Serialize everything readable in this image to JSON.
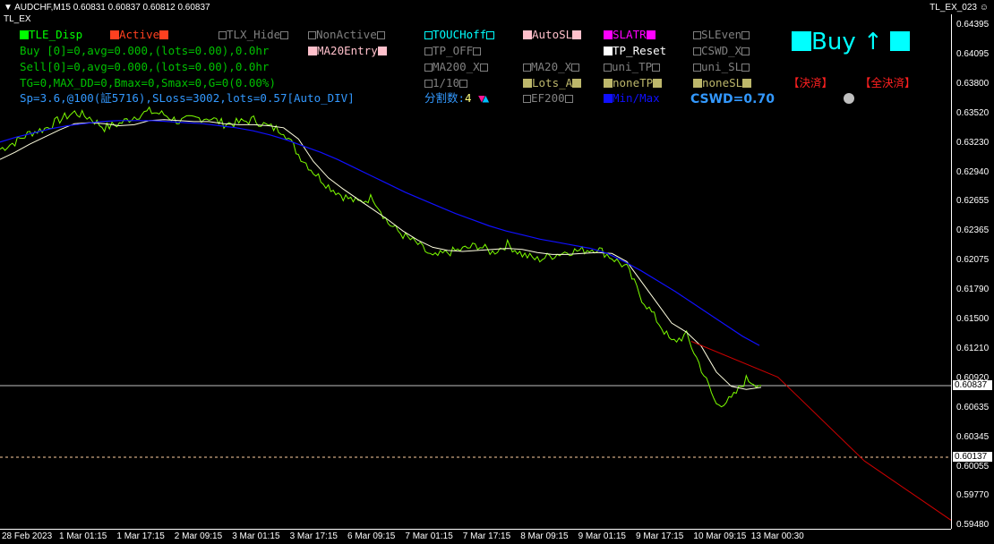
{
  "window": {
    "symbol_info": "▼ AUDCHF,M15  0.60831 0.60837 0.60812 0.60837",
    "indicator_short": "TL_EX",
    "ea_name": "TL_EX_023",
    "smiley": "☺"
  },
  "panel": {
    "tle_disp": "TLE_Disp",
    "active": "Active",
    "tlx_hide": "TLX_Hide",
    "non_active": "NonActive",
    "touch_off": "TOUCHoff",
    "auto_sl": "AutoSL",
    "slatr": "SLATR",
    "sl_even": "SLEven",
    "ma20_entry": "MA20Entry",
    "tp_off": "TP_OFF",
    "tp_reset": "TP_Reset",
    "cswd_x": "CSWD_X",
    "ma200_x": "MA200_X",
    "ma20_x": "MA20_X",
    "uni_tp": "uni_TP",
    "uni_sl": "uni_SL",
    "one_tenth": "1/10",
    "lots_a": "Lots_A",
    "none_tp": "noneTP",
    "none_sl": "noneSL",
    "split_label": "分割数:",
    "split_value": "4",
    "ef200": "EF200",
    "min_max": "Min/Max",
    "cswd_value": "CSWD=0.70",
    "buy_label": "Buy ↑",
    "settle": "【決済】",
    "settle_all": "【全決済】"
  },
  "status": {
    "buy_line": "Buy [0]=0,avg=0.000,(lots=0.00),0.0hr",
    "sell_line": "Sell[0]=0,avg=0.000,(lots=0.00),0.0hr",
    "tg_line": "TG=0,MAX_DD=0,Bmax=0,Smax=0,G=0(0.00%)",
    "sp_line": "Sp=3.6,@100(証5716),SLoss=3002,lots=0.57[Auto_DIV]"
  },
  "colors": {
    "green_text": "#00c000",
    "blue_text": "#3399ff",
    "cyan": "#00ffff",
    "red": "#ff2020",
    "magenta": "#ff00ff",
    "pink": "#ffc0cb",
    "olive": "#bdb76b",
    "price_line": "#7cfc00",
    "ma20": "#ffffe0",
    "ma200": "#1010ff",
    "trendline": "#cc0000"
  },
  "axes": {
    "y_ticks": [
      "0.64395",
      "0.64095",
      "0.63800",
      "0.63520",
      "0.63230",
      "0.62940",
      "0.62655",
      "0.62365",
      "0.62075",
      "0.61790",
      "0.61500",
      "0.61210",
      "0.60920",
      "0.60635",
      "0.60345",
      "0.60055",
      "0.59770",
      "0.59480"
    ],
    "x_ticks": [
      "28 Feb 2023",
      "1 Mar 01:15",
      "1 Mar 17:15",
      "2 Mar 09:15",
      "3 Mar 01:15",
      "3 Mar 17:15",
      "6 Mar 09:15",
      "7 Mar 01:15",
      "7 Mar 17:15",
      "8 Mar 09:15",
      "9 Mar 01:15",
      "9 Mar 17:15",
      "10 Mar 09:15",
      "13 Mar 00:30"
    ],
    "current_price": "0.60837",
    "dashed_price": "0.60137"
  },
  "chart_data": {
    "type": "line",
    "series": [
      {
        "values": [
          0.6315,
          0.6322,
          0.6331,
          0.6335,
          0.6344,
          0.6351,
          0.6346,
          0.6336,
          0.634,
          0.6347,
          0.6352,
          0.6349,
          0.6342,
          0.6345,
          0.6346,
          0.634,
          0.6341,
          0.6344,
          0.6337,
          0.6333,
          0.631,
          0.6293,
          0.6279,
          0.6269,
          0.6263,
          0.6268,
          0.6243,
          0.6231,
          0.6222,
          0.6209,
          0.6214,
          0.6217,
          0.6221,
          0.6214,
          0.6222,
          0.6212,
          0.6207,
          0.6211,
          0.6215,
          0.6216,
          0.6218,
          0.6209,
          0.6199,
          0.6169,
          0.6148,
          0.6126,
          0.6133,
          0.61,
          0.6065,
          0.607,
          0.609,
          0.6084
        ]
      },
      {
        "values": [
          0.6305,
          0.6312,
          0.632,
          0.6327,
          0.6334,
          0.634,
          0.6341,
          0.634,
          0.6338,
          0.6339,
          0.6343,
          0.6344,
          0.6343,
          0.6342,
          0.6342,
          0.634,
          0.6339,
          0.6339,
          0.6338,
          0.6336,
          0.6325,
          0.6303,
          0.6287,
          0.6276,
          0.6266,
          0.6256,
          0.6246,
          0.6235,
          0.6226,
          0.6219,
          0.6216,
          0.6215,
          0.6216,
          0.6217,
          0.6218,
          0.6217,
          0.6214,
          0.6212,
          0.6212,
          0.6213,
          0.6214,
          0.6213,
          0.6205,
          0.6185,
          0.6165,
          0.6145,
          0.6136,
          0.6122,
          0.6097,
          0.6083,
          0.608,
          0.6082
        ]
      },
      {
        "values": [
          0.6322,
          0.6327,
          0.6331,
          0.6335,
          0.6338,
          0.634,
          0.6342,
          0.6343,
          0.6343,
          0.6343,
          0.6342,
          0.6341,
          0.634,
          0.6338,
          0.6336,
          0.6333,
          0.6329,
          0.6324,
          0.6318,
          0.6312,
          0.6305,
          0.6297,
          0.6289,
          0.6281,
          0.6273,
          0.6266,
          0.6259,
          0.6252,
          0.6246,
          0.624,
          0.6235,
          0.6231,
          0.6227,
          0.6224,
          0.6221,
          0.6218,
          0.6213,
          0.6205,
          0.6196,
          0.6186,
          0.6176,
          0.6165,
          0.6154,
          0.6143,
          0.6132,
          0.6123
        ]
      },
      {
        "values": [
          0.6127,
          0.6092,
          0.601,
          0.5952
        ]
      }
    ],
    "ylim": [
      0.5948,
      0.644
    ]
  }
}
